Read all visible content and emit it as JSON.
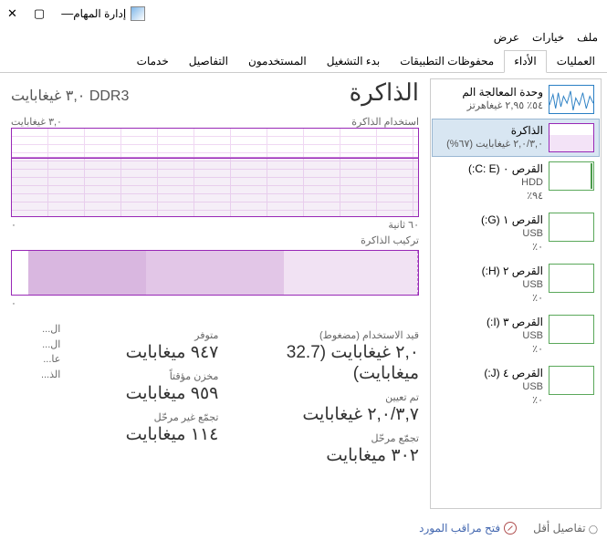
{
  "window": {
    "title": "إدارة المهام"
  },
  "menu": {
    "file": "ملف",
    "options": "خيارات",
    "view": "عرض"
  },
  "tabs": {
    "processes": "العمليات",
    "performance": "الأداء",
    "app_history": "محفوظات التطبيقات",
    "startup": "بدء التشغيل",
    "users": "المستخدمون",
    "details": "التفاصيل",
    "services": "خدمات"
  },
  "sidebar": {
    "cpu": {
      "title": "وحدة المعالجة الم",
      "sub": "٥٤٪ ٢,٩٥ غيغاهرتز"
    },
    "memory": {
      "title": "الذاكرة",
      "sub": "٢,٠/٣,٠ غيغابايت (٦٧%)"
    },
    "disk0": {
      "title": "القرص ٠ (C: E:)",
      "sub1": "HDD",
      "sub2": "٩٤٪"
    },
    "disk1": {
      "title": "القرص ١ (G:)",
      "sub1": "USB",
      "sub2": "٠٪"
    },
    "disk2": {
      "title": "القرص ٢ (H:)",
      "sub1": "USB",
      "sub2": "٠٪"
    },
    "disk3": {
      "title": "القرص ٣ (I:)",
      "sub1": "USB",
      "sub2": "٠٪"
    },
    "disk4": {
      "title": "القرص ٤ (J:)",
      "sub1": "USB",
      "sub2": "٠٪"
    }
  },
  "main": {
    "title": "الذاكرة",
    "subtitle": "٣,٠ غيغابايت DDR3",
    "chart_usage_label": "استخدام الذاكرة",
    "chart_y_max": "٣,٠ غيغابايت",
    "chart_x_start": "٦٠ ثانية",
    "chart_x_end": "٠",
    "chart_y_min": "٠",
    "comp_label": "تركيب الذاكرة",
    "stats": {
      "in_use_label": "قيد الاستخدام (مضغوط)",
      "in_use_value": "٢,٠ غيغابايت (32.7 ميغابايت)",
      "available_label": "متوفر",
      "available_value": "٩٤٧ ميغابايت",
      "committed_label": "تم تعيين",
      "committed_value": "٢,٠/٣,٧ غيغابايت",
      "cached_label": "مخزن مؤقتاً",
      "cached_value": "٩٥٩ ميغابايت",
      "paged_label": "تجمّع مرحّل",
      "paged_value": "٣٠٢ ميغابايت",
      "nonpaged_label": "تجمّع غير مرحّل",
      "nonpaged_value": "١١٤ ميغابايت"
    },
    "trunc": {
      "t1": "ال...",
      "t2": "ال...",
      "t3": "عا...",
      "t4": "الذ..."
    }
  },
  "footer": {
    "fewer_details": "تفاصيل أقل",
    "open_monitor": "فتح مراقب المورد"
  },
  "chart_data": {
    "type": "area",
    "title": "استخدام الذاكرة",
    "ylabel": "غيغابايت",
    "xlabel": "ثانية",
    "ylim": [
      0,
      3.0
    ],
    "xlim": [
      60,
      0
    ],
    "x": [
      60,
      55,
      50,
      45,
      40,
      35,
      30,
      25,
      20,
      15,
      10,
      5,
      0
    ],
    "values": [
      2.0,
      2.0,
      2.0,
      2.05,
      2.1,
      2.05,
      2.0,
      2.0,
      2.0,
      2.0,
      2.0,
      2.0,
      2.0
    ]
  }
}
